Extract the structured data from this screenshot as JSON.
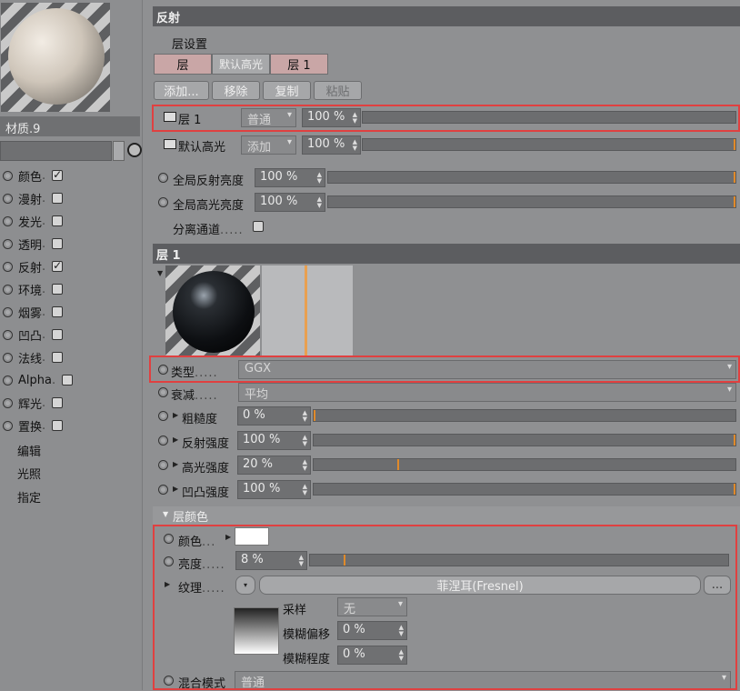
{
  "material": {
    "name": "材质.9"
  },
  "channels": [
    {
      "label": "颜色",
      "checked": true
    },
    {
      "label": "漫射",
      "checked": false
    },
    {
      "label": "发光",
      "checked": false
    },
    {
      "label": "透明",
      "checked": false
    },
    {
      "label": "反射",
      "checked": true
    },
    {
      "label": "环境",
      "checked": false
    },
    {
      "label": "烟雾",
      "checked": false
    },
    {
      "label": "凹凸",
      "checked": false
    },
    {
      "label": "法线",
      "checked": false
    },
    {
      "label": "Alpha",
      "checked": false
    },
    {
      "label": "辉光",
      "checked": false
    },
    {
      "label": "置换",
      "checked": false
    }
  ],
  "extra_items": [
    "编辑",
    "光照",
    "指定"
  ],
  "reflection": {
    "header": "反射",
    "layer_settings_label": "层设置",
    "tabs": [
      "层",
      "默认高光",
      "层 1"
    ],
    "buttons": {
      "add": "添加...",
      "remove": "移除",
      "copy": "复制",
      "paste": "粘贴"
    },
    "layers": [
      {
        "name": "层 1",
        "mode": "普通",
        "percent": "100 %"
      },
      {
        "name": "默认高光",
        "mode": "添加",
        "percent": "100 %"
      }
    ],
    "global_reflection": {
      "label": "全局反射亮度",
      "value": "100 %"
    },
    "global_specular": {
      "label": "全局高光亮度",
      "value": "100 %"
    },
    "separate_pass": {
      "label": "分离通道",
      "checked": false
    }
  },
  "layer1": {
    "header": "层 1",
    "type": {
      "label": "类型",
      "value": "GGX"
    },
    "attenuation": {
      "label": "衰减",
      "value": "平均"
    },
    "roughness": {
      "label": "粗糙度",
      "value": "0 %",
      "level": 0.0
    },
    "reflection_strength": {
      "label": "反射强度",
      "value": "100 %",
      "level": 1.0
    },
    "specular_strength": {
      "label": "高光强度",
      "value": "20 %",
      "level": 0.2
    },
    "bump_strength": {
      "label": "凹凸强度",
      "value": "100 %",
      "level": 1.0
    }
  },
  "layer_color": {
    "header": "层颜色",
    "color": {
      "label": "颜色",
      "swatch": "#ffffff"
    },
    "brightness": {
      "label": "亮度",
      "value": "8 %",
      "level": 0.08
    },
    "texture": {
      "label": "纹理",
      "shader": "菲涅耳(Fresnel)",
      "more": "..."
    },
    "sampling": {
      "label": "采样",
      "value": "无"
    },
    "blur_offset": {
      "label": "模糊偏移",
      "value": "0 %"
    },
    "blur_scale": {
      "label": "模糊程度",
      "value": "0 %"
    },
    "blend_mode": {
      "label": "混合模式",
      "value": "普通"
    }
  },
  "colors": {
    "highlight_box": "#e04040",
    "slider_knob": "#e08a2a"
  }
}
